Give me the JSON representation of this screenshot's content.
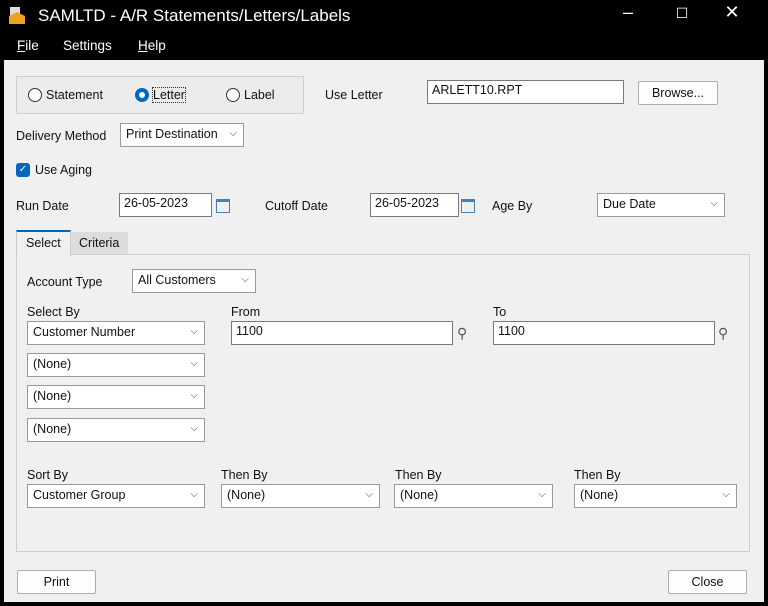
{
  "window": {
    "title": "SAMLTD - A/R Statements/Letters/Labels",
    "minimize": "–",
    "maximize": "☐",
    "close": "✕"
  },
  "menu": [
    {
      "label": "File",
      "u": "F",
      "rest": "ile"
    },
    {
      "label": "Settings",
      "u": "Se",
      "rest": "ttings"
    },
    {
      "label": "Help",
      "u": "H",
      "rest": "elp"
    }
  ],
  "type_options": {
    "statement": "Statement",
    "letter": "Letter",
    "label": "Label",
    "selected": "Letter"
  },
  "use_letter": {
    "label": "Use Letter",
    "value": "ARLETT10.RPT",
    "browse": "Browse..."
  },
  "delivery": {
    "label": "Delivery Method",
    "value": "Print Destination"
  },
  "use_aging": {
    "label": "Use Aging",
    "checked": true
  },
  "run_date": {
    "label": "Run Date",
    "value": "26-05-2023"
  },
  "cutoff_date": {
    "label": "Cutoff Date",
    "value": "26-05-2023"
  },
  "age_by": {
    "label": "Age By",
    "value": "Due Date"
  },
  "tabs": [
    {
      "label": "Select",
      "active": true
    },
    {
      "label": "Criteria",
      "active": false
    }
  ],
  "select": {
    "account_type_label": "Account Type",
    "account_type": "All Customers",
    "select_by_label": "Select By",
    "from_label": "From",
    "to_label": "To",
    "select_by": [
      "Customer Number",
      "(None)",
      "(None)",
      "(None)"
    ],
    "from": "1100",
    "to": "1100",
    "sort_by_label": "Sort By",
    "then_by_label": "Then By",
    "sort": [
      "Customer Group",
      "(None)",
      "(None)",
      "(None)"
    ]
  },
  "buttons": {
    "print": "Print",
    "close": "Close"
  }
}
